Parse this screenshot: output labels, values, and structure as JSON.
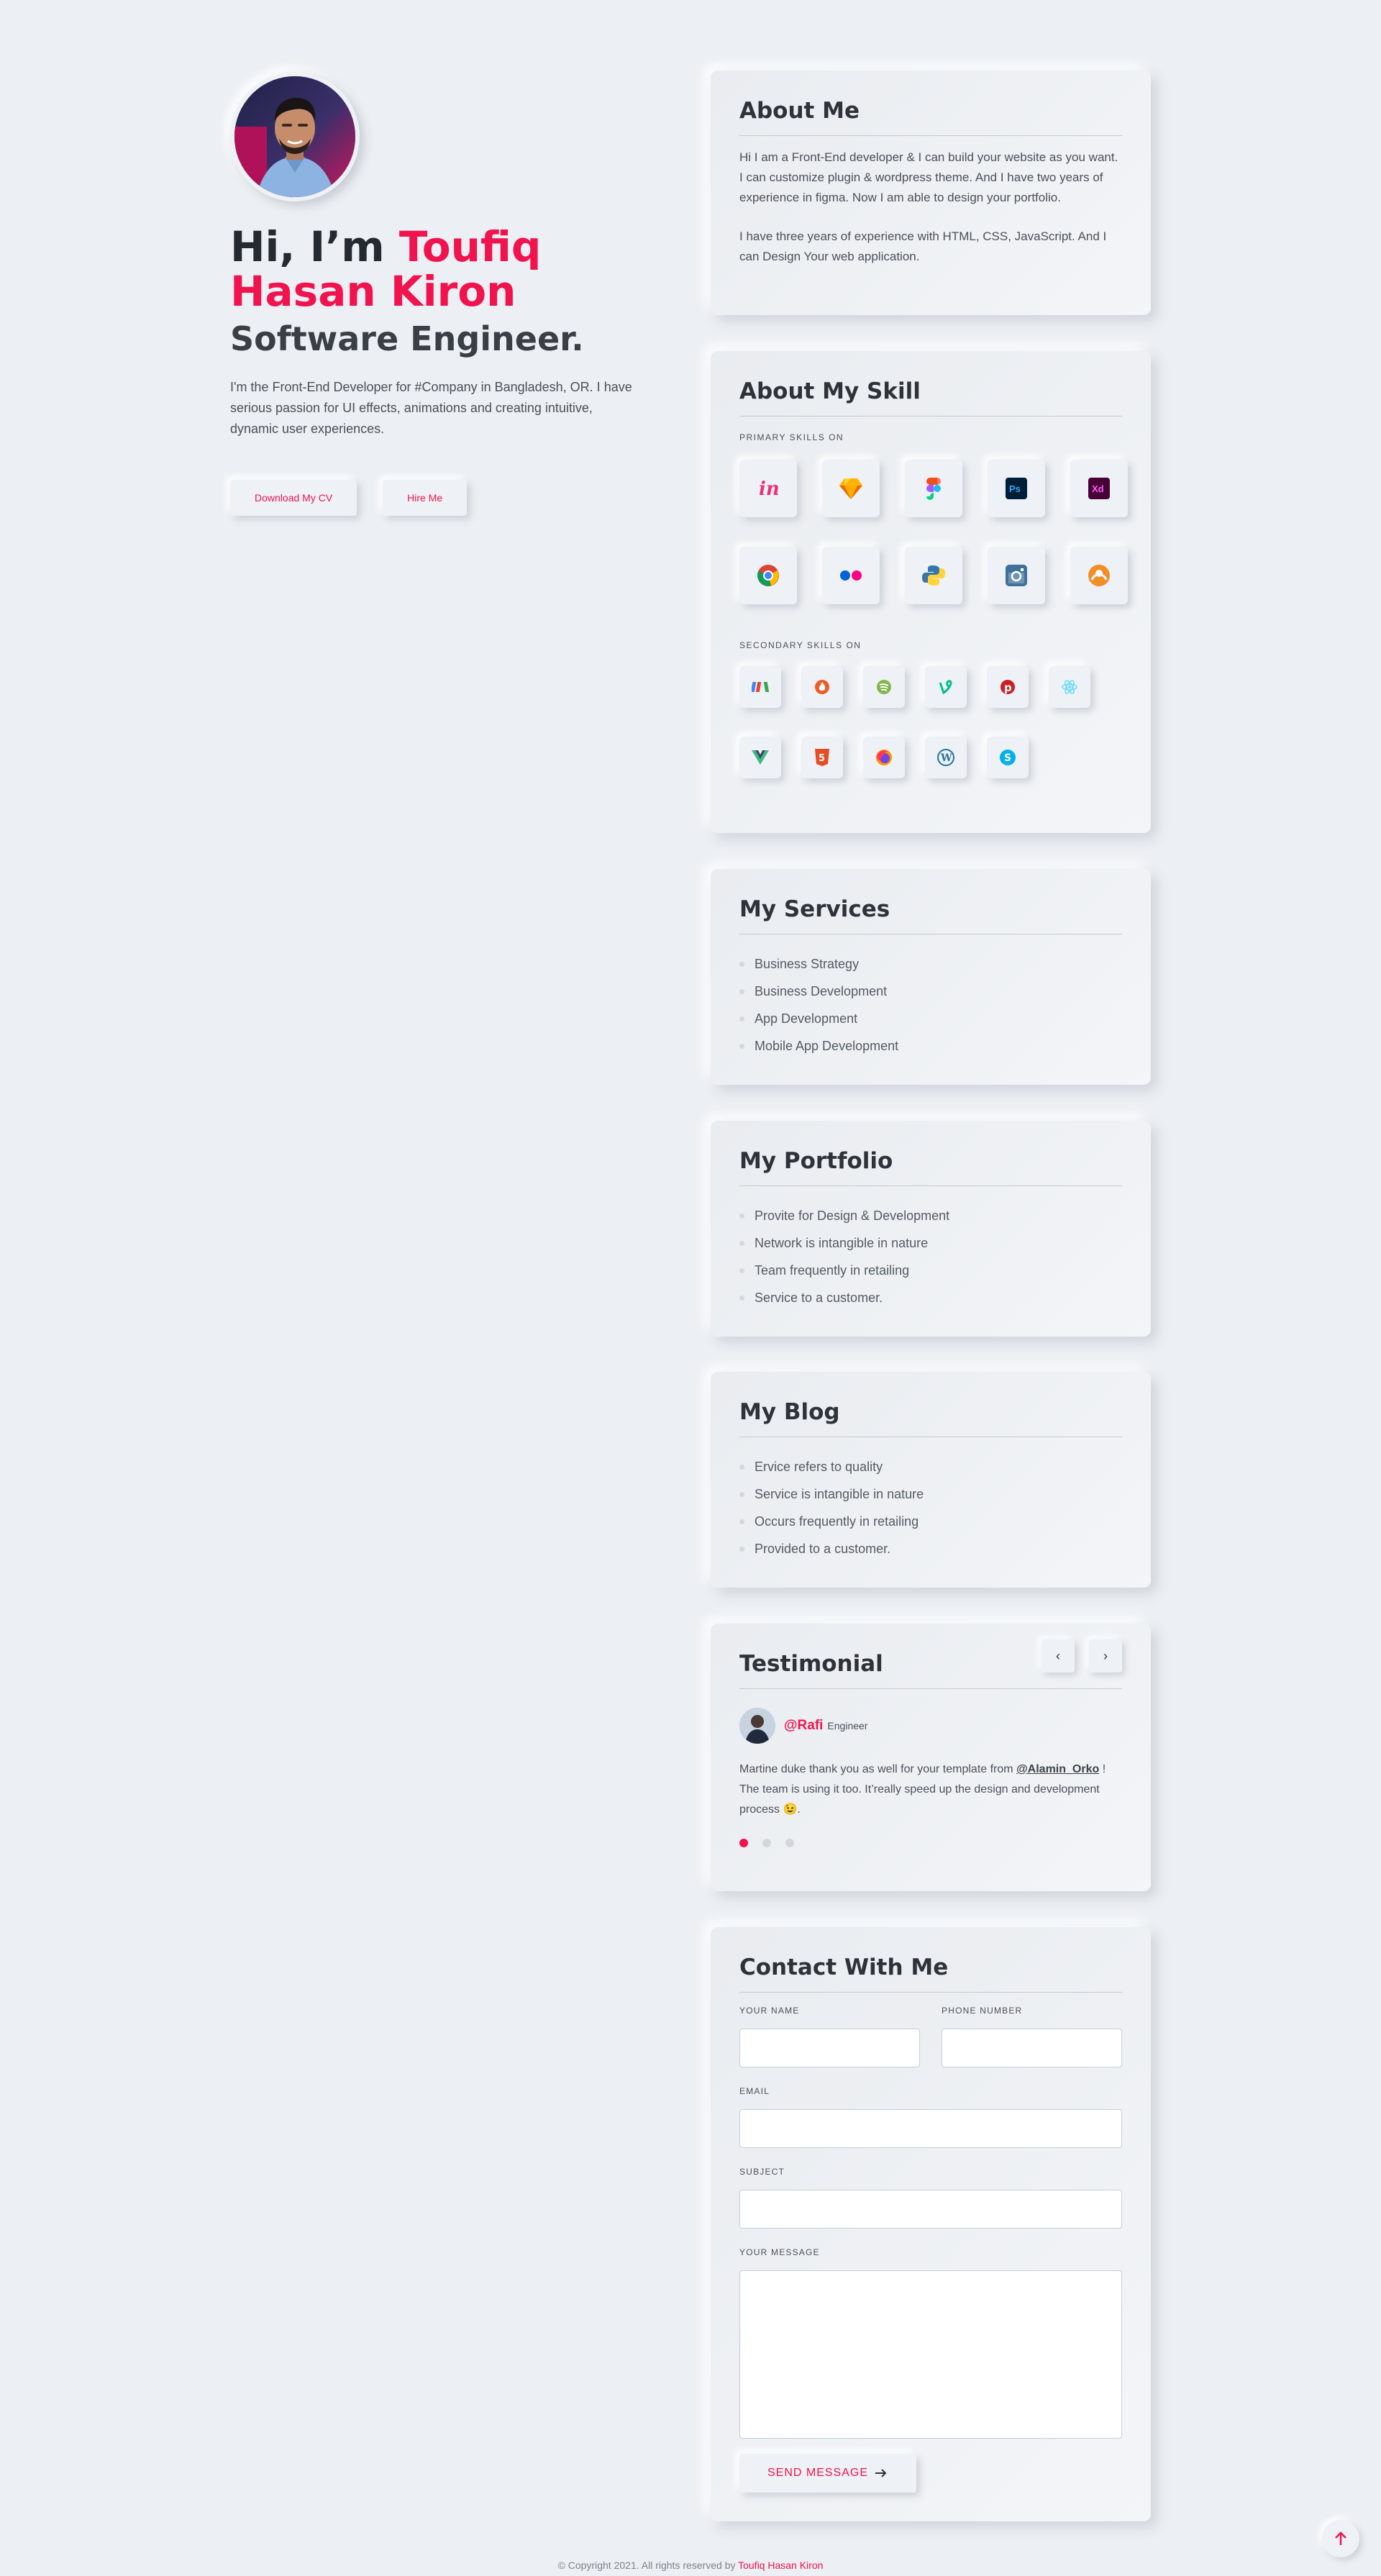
{
  "hero": {
    "greeting": "Hi, I’m ",
    "name_line1": "Toufiq",
    "name_line2": "Hasan Kiron",
    "role": "Software Engineer.",
    "description": "I'm the Front-End Developer for #Company in Bangladesh, OR. I have serious passion for UI effects, animations and creating intuitive, dynamic user experiences.",
    "download_label": "Download My CV",
    "hire_label": "Hire Me"
  },
  "about": {
    "title": "About Me",
    "para1": "Hi I am a Front-End developer & I can build your website as you want. I can customize plugin & wordpress theme. And I have two years of experience in figma. Now I am able to design your portfolio.",
    "para2": "I have three years of experience with HTML, CSS, JavaScript. And I can Design Your web application."
  },
  "skills": {
    "title": "About My Skill",
    "primary_label": "PRIMARY SKILLS ON",
    "secondary_label": "SECONDARY SKILLS ON",
    "primary": [
      "invision-icon",
      "sketch-icon",
      "figma-icon",
      "photoshop-icon",
      "xd-icon",
      "chrome-icon",
      "flickr-icon",
      "python-icon",
      "instagram-icon",
      "grav-icon"
    ],
    "secondary": [
      "codepen-icon",
      "firebase-icon",
      "spotify-icon",
      "vine-icon",
      "pinterest-icon",
      "react-icon",
      "vue-icon",
      "html5-icon",
      "firefox-icon",
      "wordpress-icon",
      "skype-icon"
    ]
  },
  "services": {
    "title": "My Services",
    "items": [
      "Business Strategy",
      "Business Development",
      "App Development",
      "Mobile App Development"
    ]
  },
  "portfolio": {
    "title": "My Portfolio",
    "items": [
      "Provite for Design & Development",
      "Network is intangible in nature",
      "Team frequently in retailing",
      "Service to a customer."
    ]
  },
  "blog": {
    "title": "My Blog",
    "items": [
      "Ervice refers to quality",
      "Service is intangible in nature",
      "Occurs frequently in retailing",
      "Provided to a customer."
    ]
  },
  "testimonial": {
    "title": "Testimonial",
    "prev": "‹",
    "next": "›",
    "handle": "@Rafi",
    "role": "Engineer",
    "text_before": "Martine duke thank you as well for your template from ",
    "mention": "@Alamin_Orko",
    "text_after": " ! The team is using it too. It’really speed up the design and development process ",
    "emoji": "😉",
    "text_end": ".",
    "dots": 3,
    "active_dot": 0
  },
  "contact": {
    "title": "Contact With Me",
    "name_label": "YOUR NAME",
    "phone_label": "PHONE NUMBER",
    "email_label": "EMAIL",
    "subject_label": "SUBJECT",
    "message_label": "YOUR MESSAGE",
    "send_label": "SEND MESSAGE",
    "name_value": "",
    "phone_value": "",
    "email_value": "",
    "subject_value": "",
    "message_value": ""
  },
  "footer": {
    "copyright": "© Copyright 2021. All rights reserved by ",
    "author": "Toufiq Hasan Kiron"
  },
  "colors": {
    "accent": "#f0134d",
    "background": "#eceff3"
  }
}
